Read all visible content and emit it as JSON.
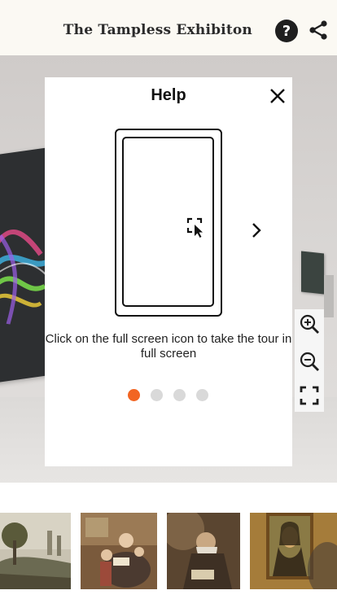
{
  "header": {
    "title": "The Tampless Exhibiton",
    "help_icon_glyph": "?",
    "help_icon": "question-icon",
    "share_icon": "share-icon",
    "background": "#fbf9f3"
  },
  "modal": {
    "title": "Help",
    "close_icon": "close-icon",
    "illustration": "phone-fullscreen-icon",
    "next_icon": "chevron-right-icon",
    "instruction": "Click on the full screen icon to take the tour in full screen",
    "pagination": {
      "total": 4,
      "active_index": 0,
      "active_color": "#f26522",
      "inactive_color": "#d9d9d9"
    }
  },
  "zoom_controls": {
    "items": [
      "zoom-in-icon",
      "zoom-out-icon",
      "fullscreen-icon"
    ]
  },
  "thumbnails": [
    {
      "name": "landscape-painting"
    },
    {
      "name": "family-reading-painting"
    },
    {
      "name": "old-scholar-painting"
    },
    {
      "name": "mona-lisa-painting"
    }
  ]
}
